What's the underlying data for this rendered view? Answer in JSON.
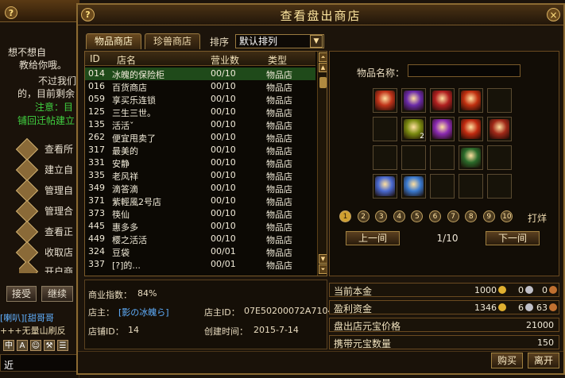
{
  "background": {
    "text_lines": [
      "想不想自",
      "教给你哦。",
      "不过我们",
      "的，目前剩余",
      "注意：目",
      "铺回迁帖建立"
    ],
    "menu": [
      "查看所",
      "建立自",
      "管理自",
      "管理合",
      "查看正",
      "收取店",
      "开户商"
    ],
    "buttons": [
      "接受",
      "继续"
    ],
    "chat": [
      "[喇叭][甜哥哥",
      "+++无量山刷反"
    ],
    "input_prefix": "近",
    "tools": [
      "中",
      "A",
      "☺",
      "⚒",
      "☰",
      "♪"
    ]
  },
  "window": {
    "title": "查看盘出商店",
    "help": "?",
    "close": "×",
    "tabs": [
      "物品商店",
      "珍兽商店"
    ],
    "sort_label": "排序",
    "sort_value": "默认排列",
    "table": {
      "headers": [
        "ID",
        "店名",
        "营业数",
        "类型"
      ],
      "rows": [
        [
          "014",
          "冰魄的保险柜",
          "00/10",
          "物品店"
        ],
        [
          "016",
          "百货商店",
          "00/10",
          "物品店"
        ],
        [
          "059",
          "享买乐连锁",
          "00/10",
          "物品店"
        ],
        [
          "125",
          "三生三世。",
          "00/10",
          "物品店"
        ],
        [
          "135",
          "活活ˇ",
          "00/10",
          "物品店"
        ],
        [
          "262",
          "便宜甩卖了",
          "00/10",
          "物品店"
        ],
        [
          "317",
          "最美的",
          "00/10",
          "物品店"
        ],
        [
          "331",
          "安静",
          "00/10",
          "物品店"
        ],
        [
          "335",
          "老风祥",
          "00/10",
          "物品店"
        ],
        [
          "349",
          "滴答滴",
          "00/10",
          "物品店"
        ],
        [
          "371",
          "紫輕風2号店",
          "00/10",
          "物品店"
        ],
        [
          "373",
          "筷仙",
          "00/10",
          "物品店"
        ],
        [
          "445",
          "惠多多",
          "00/10",
          "物品店"
        ],
        [
          "449",
          "樱之活活",
          "00/10",
          "物品店"
        ],
        [
          "324",
          "豆袋",
          "00/01",
          "物品店"
        ],
        [
          "337",
          "[?]的...",
          "00/01",
          "物品店"
        ]
      ]
    },
    "info": {
      "index_label": "商业指数：",
      "index_value": "84%",
      "owner_label": "店主：",
      "owner_value": "[影の冰魄ら]",
      "owner_id_label": "店主ID：",
      "owner_id_value": "07E50200072A7104",
      "shop_id_label": "店铺ID：",
      "shop_id_value": "14",
      "created_label": "创建时间：",
      "created_value": "2015-7-14"
    },
    "item_panel": {
      "name_label": "物品名称：",
      "slots": [
        {
          "color": "#c0341a",
          "count": ""
        },
        {
          "color": "#6a2aa8",
          "count": ""
        },
        {
          "color": "#b02020",
          "count": ""
        },
        {
          "color": "#c03010",
          "count": ""
        },
        null,
        null,
        {
          "color": "#7a8a10",
          "count": "2"
        },
        {
          "color": "#8a2ab0",
          "count": ""
        },
        {
          "color": "#c02a10",
          "count": ""
        },
        {
          "color": "#a02818",
          "count": ""
        },
        null,
        null,
        null,
        {
          "color": "#2a6a2a",
          "count": ""
        },
        null,
        {
          "color": "#4a6ad0",
          "count": ""
        },
        {
          "color": "#3a7ad0",
          "count": ""
        },
        null,
        null,
        null
      ],
      "pages": [
        "1",
        "2",
        "3",
        "4",
        "5",
        "6",
        "7",
        "8",
        "9",
        "10"
      ],
      "current_page": 1,
      "refine": "打烊",
      "prev": "上一间",
      "next": "下一间",
      "page_indicator": "1/10"
    },
    "stats": [
      {
        "label": "当前本金",
        "gold": "1000",
        "silver": "0",
        "copper": "0"
      },
      {
        "label": "盈利资金",
        "gold": "1346",
        "silver": "6",
        "copper": "63"
      },
      {
        "label": "盘出店元宝价格",
        "value": "21000"
      },
      {
        "label": "携带元宝数量",
        "value": "150"
      }
    ],
    "buy": "购买",
    "leave": "离开"
  }
}
